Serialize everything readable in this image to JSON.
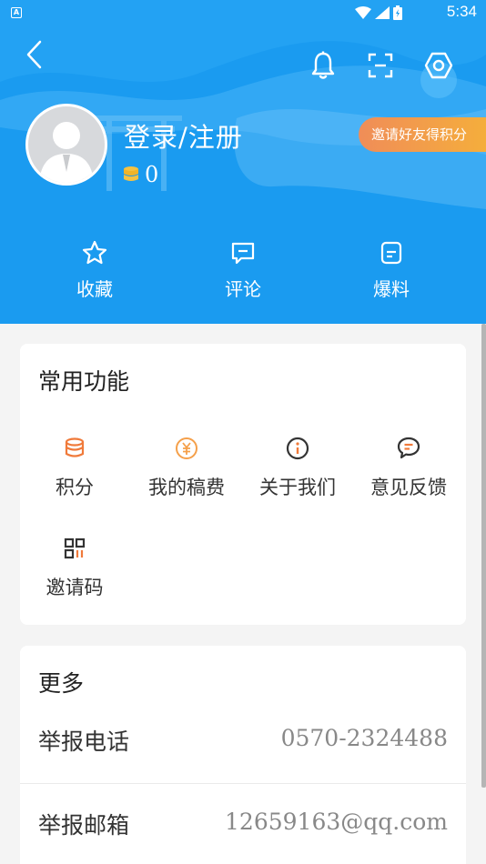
{
  "status_bar": {
    "time": "5:34",
    "app_badge": "A"
  },
  "header": {
    "login_text": "登录/注册",
    "coin_count": "0",
    "invite_label": "邀请好友得积分",
    "quick_actions": [
      {
        "label": "收藏",
        "icon": "star-icon"
      },
      {
        "label": "评论",
        "icon": "comment-icon"
      },
      {
        "label": "爆料",
        "icon": "report-icon"
      }
    ]
  },
  "common_functions": {
    "title": "常用功能",
    "items": [
      {
        "label": "积分",
        "icon": "coins-icon"
      },
      {
        "label": "我的稿费",
        "icon": "yuan-icon"
      },
      {
        "label": "关于我们",
        "icon": "info-icon"
      },
      {
        "label": "意见反馈",
        "icon": "feedback-icon"
      },
      {
        "label": "邀请码",
        "icon": "qrcode-icon"
      }
    ]
  },
  "more": {
    "title": "更多",
    "rows": [
      {
        "label": "举报电话",
        "value": "0570-2324488"
      },
      {
        "label": "举报邮箱",
        "value": "12659163@qq.com"
      }
    ]
  },
  "colors": {
    "header_blue": "#1a9bf0",
    "accent_orange": "#f08d58",
    "coin_gold": "#f5c242"
  }
}
